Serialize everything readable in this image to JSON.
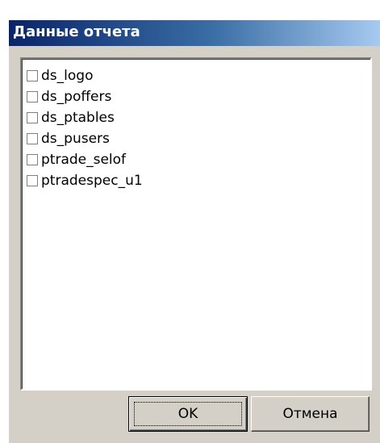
{
  "window": {
    "title": "Данные отчета"
  },
  "list": {
    "items": [
      {
        "label": "ds_logo",
        "checked": false
      },
      {
        "label": "ds_poffers",
        "checked": false
      },
      {
        "label": "ds_ptables",
        "checked": false
      },
      {
        "label": "ds_pusers",
        "checked": false
      },
      {
        "label": "ptrade_selof",
        "checked": false
      },
      {
        "label": "ptradespec_u1",
        "checked": false
      }
    ]
  },
  "buttons": {
    "ok_label": "OK",
    "cancel_label": "Отмена"
  },
  "colors": {
    "titlebar_start": "#0a246a",
    "titlebar_end": "#a6caf0",
    "dialog_background": "#d4d0c8"
  }
}
